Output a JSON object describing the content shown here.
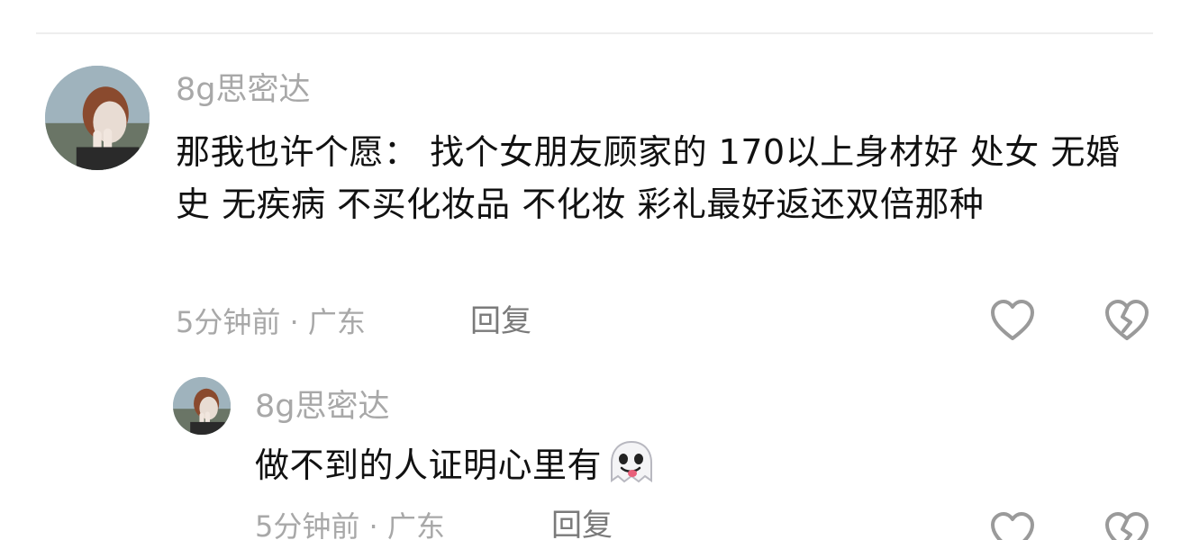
{
  "comments": [
    {
      "username": "8g思密达",
      "text": "那我也许个愿： 找个女朋友顾家的 170以上身材好 处女 无婚史 无疾病 不买化妆品 不化妆 彩礼最好返还双倍那种",
      "meta": "5分钟前 · 广东",
      "reply_label": "回复",
      "avatar_icon": "avatar-image",
      "like_icon": "heart-outline-icon",
      "dislike_icon": "broken-heart-icon"
    },
    {
      "username": "8g思密达",
      "text": "做不到的人证明心里有",
      "emoji": "ghost-emoji",
      "meta": "5分钟前 · 广东",
      "reply_label": "回复",
      "avatar_icon": "avatar-image",
      "like_icon": "heart-outline-icon",
      "dislike_icon": "broken-heart-icon"
    }
  ],
  "colors": {
    "meta_text": "#a8a8a8",
    "body_text": "#111111",
    "icon_stroke": "#9a9a9a",
    "divider": "#eeeeee"
  }
}
